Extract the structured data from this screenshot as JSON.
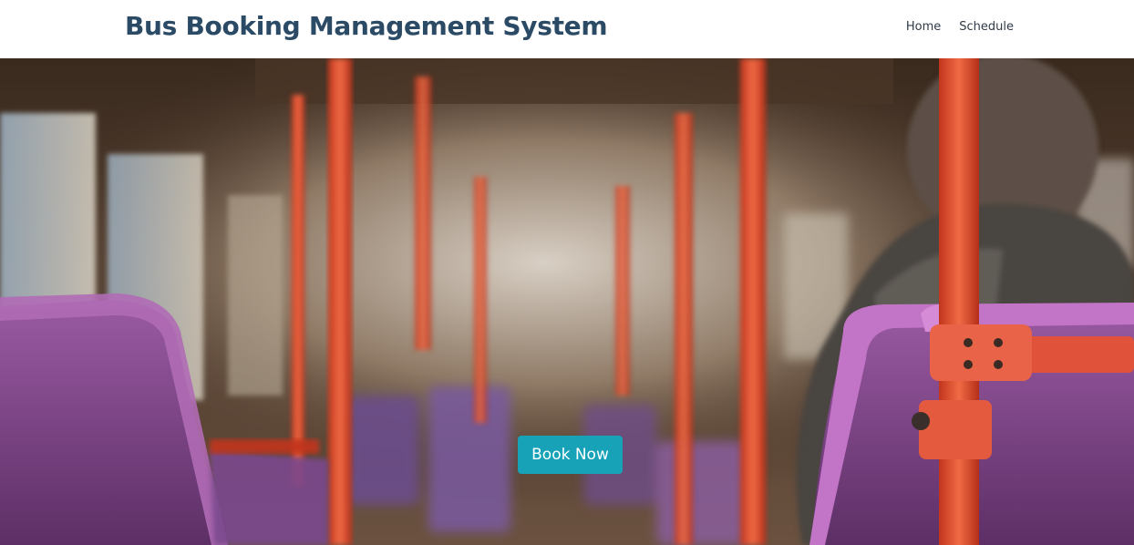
{
  "header": {
    "title": "Bus Booking Management System",
    "nav": [
      {
        "label": "Home"
      },
      {
        "label": "Schedule"
      }
    ]
  },
  "hero": {
    "image": "bus-interior-photo",
    "cta_label": "Book Now"
  },
  "colors": {
    "brand_text": "#2b4a66",
    "button_bg": "#17a2b8",
    "button_text": "#ffffff"
  }
}
